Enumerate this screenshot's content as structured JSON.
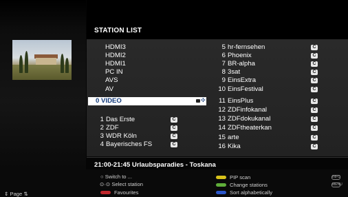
{
  "list_title": "STATION LIST",
  "left_column": [
    {
      "num": "",
      "name": "HDMI3",
      "badge": ""
    },
    {
      "num": "",
      "name": "HDMI2",
      "badge": ""
    },
    {
      "num": "",
      "name": "HDMI1",
      "badge": ""
    },
    {
      "num": "",
      "name": "PC IN",
      "badge": ""
    },
    {
      "num": "",
      "name": "AVS",
      "badge": ""
    },
    {
      "num": "",
      "name": "AV",
      "badge": ""
    },
    {
      "num": "0",
      "name": "VIDEO",
      "badge": ""
    },
    {
      "num": "1",
      "name": "Das Erste",
      "badge": "C"
    },
    {
      "num": "2",
      "name": "ZDF",
      "badge": "C"
    },
    {
      "num": "3",
      "name": "WDR Köln",
      "badge": "C"
    },
    {
      "num": "4",
      "name": "Bayerisches FS",
      "badge": "C"
    }
  ],
  "right_column": [
    {
      "num": "5",
      "name": "hr-fernsehen",
      "badge": "C"
    },
    {
      "num": "6",
      "name": "Phoenix",
      "badge": "C"
    },
    {
      "num": "7",
      "name": "BR-alpha",
      "badge": "C"
    },
    {
      "num": "8",
      "name": "3sat",
      "badge": "C"
    },
    {
      "num": "9",
      "name": "EinsExtra",
      "badge": "C"
    },
    {
      "num": "10",
      "name": "EinsFestival",
      "badge": "C"
    },
    {
      "num": "11",
      "name": "EinsPlus",
      "badge": "C"
    },
    {
      "num": "12",
      "name": "ZDFinfokanal",
      "badge": "C"
    },
    {
      "num": "13",
      "name": "ZDFdokukanal",
      "badge": "C"
    },
    {
      "num": "14",
      "name": "ZDFtheaterkan",
      "badge": "C"
    },
    {
      "num": "15",
      "name": "arte",
      "badge": "C"
    },
    {
      "num": "16",
      "name": "Kika",
      "badge": "C"
    }
  ],
  "epg": "21:00-21:45 Urlaubsparadies - Toskana",
  "footer": {
    "page": "Page",
    "page_arrows": "⇅",
    "switch_to": "Switch to ...",
    "select_station": "Select station",
    "favourites": "Favourites",
    "pip_scan": "PIP scan",
    "change_stations": "Change stations",
    "sort_alpha": "Sort alphabetically",
    "info_key": "INFO",
    "menu_key": "MENU"
  },
  "colors": {
    "red": "#c0282d",
    "yellow": "#d8c21a",
    "green": "#5fae3a",
    "blue": "#2a56c9",
    "selection_text": "#123a7a"
  },
  "icons": {
    "ok": "ok-circle-icon",
    "nav": "up-down-arrows-icon",
    "sel_icon": "move-arrows-icon"
  }
}
